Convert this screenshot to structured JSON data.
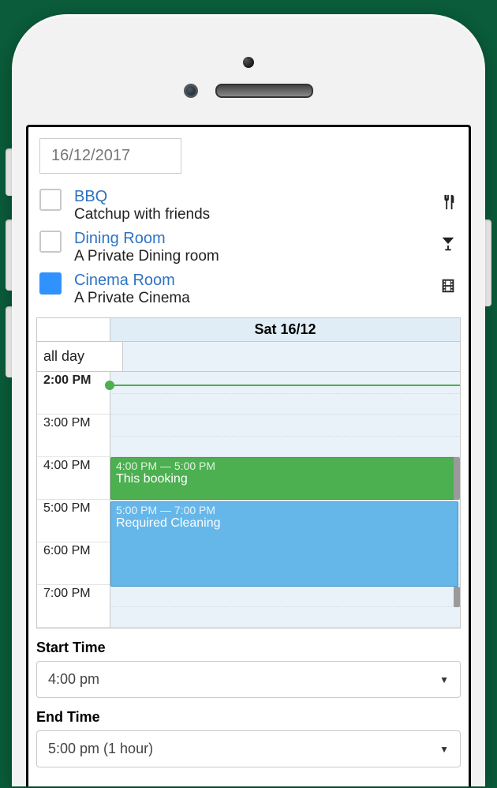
{
  "date_input": {
    "value": "16/12/2017"
  },
  "resources": [
    {
      "title": "BBQ",
      "desc": "Catchup with friends",
      "icon": "utensils",
      "checked": false
    },
    {
      "title": "Dining Room",
      "desc": "A Private Dining room",
      "icon": "martini",
      "checked": false
    },
    {
      "title": "Cinema Room",
      "desc": "A Private Cinema",
      "icon": "film",
      "checked": true
    }
  ],
  "calendar": {
    "header": "Sat 16/12",
    "allday_label": "all day",
    "hours": [
      "2:00 PM",
      "3:00 PM",
      "4:00 PM",
      "5:00 PM",
      "6:00 PM",
      "7:00 PM"
    ]
  },
  "events": [
    {
      "time": "4:00 PM — 5:00 PM",
      "title": "This booking",
      "color": "green"
    },
    {
      "time": "5:00 PM — 7:00 PM",
      "title": "Required Cleaning",
      "color": "blue"
    }
  ],
  "form": {
    "start_label": "Start Time",
    "start_value": "4:00 pm",
    "end_label": "End Time",
    "end_value": "5:00 pm (1 hour)"
  }
}
